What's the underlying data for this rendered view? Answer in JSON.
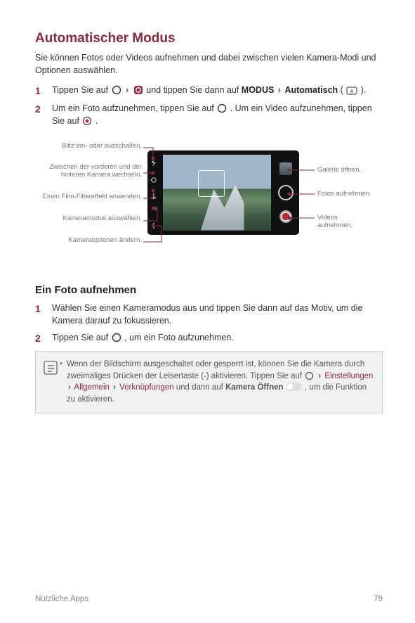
{
  "title": "Automatischer Modus",
  "intro": "Sie können Fotos oder Videos aufnehmen und dabei zwischen vielen Kamera-Modi und Optionen auswählen.",
  "step1": {
    "a": "Tippen Sie auf ",
    "b": " und tippen Sie dann auf ",
    "modus": "MODUS",
    "auto": "Automatisch",
    "c": "."
  },
  "step2": {
    "a": "Um ein Foto aufzunehmen, tippen Sie auf ",
    "b": ". Um ein Video aufzunehmen, tippen Sie auf ",
    "c": "."
  },
  "callouts": {
    "left": [
      "Blitz ein- oder ausschalten.",
      "Zwischen der vorderen und der hinteren Kamera wechseln.",
      "Einen Film-Filtereffekt anwenden.",
      "Kameramodus auswählen.",
      "Kameraoptionen ändern."
    ],
    "right": [
      "Galerie öffnen.",
      "Fotos aufnehmen.",
      "Videos aufnehmen."
    ]
  },
  "section2": {
    "heading": "Ein Foto aufnehmen",
    "step1": "Wählen Sie einen Kameramodus aus und tippen Sie dann auf das Motiv, um die Kamera darauf zu fokussieren.",
    "step2a": "Tippen Sie auf ",
    "step2b": ", um ein Foto aufzunehmen."
  },
  "note": {
    "a": "Wenn der Bildschirm ausgeschaltet oder gesperrt ist, können Sie die Kamera durch zweimaliges Drücken der Leisertaste (-) aktivieren. Tippen Sie auf ",
    "b": "Einstellungen",
    "c": "Allgemein",
    "d": "Verknüpfungen",
    "e": " und dann auf ",
    "f": "Kamera Öffnen",
    "g": ", um die Funktion zu aktivieren."
  },
  "footer": {
    "left": "Nützliche Apps",
    "right": "79"
  }
}
